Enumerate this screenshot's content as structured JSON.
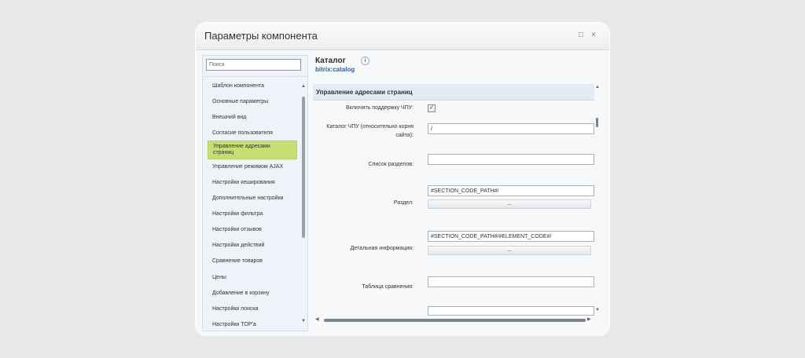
{
  "window": {
    "title": "Параметры компонента",
    "maximize_icon": "□",
    "close_icon": "×"
  },
  "sidebar": {
    "search_placeholder": "Поиск",
    "items": [
      {
        "label": "Шаблон компонента"
      },
      {
        "label": "Основные параметры"
      },
      {
        "label": "Внешний вид"
      },
      {
        "label": "Согласие пользователя"
      },
      {
        "label": "Управление адресами страниц",
        "active": true
      },
      {
        "label": "Управление режимом AJAX"
      },
      {
        "label": "Настройки кеширования"
      },
      {
        "label": "Дополнительные настройки"
      },
      {
        "label": "Настройки фильтра"
      },
      {
        "label": "Настройки отзывов"
      },
      {
        "label": "Настройки действий"
      },
      {
        "label": "Сравнение товаров"
      },
      {
        "label": "Цены"
      },
      {
        "label": "Добавление в корзину"
      },
      {
        "label": "Настройки поиска"
      },
      {
        "label": "Настройки TOP'a"
      }
    ]
  },
  "main": {
    "component_title": "Каталог",
    "component_code": "bitrix:catalog",
    "info_icon": "i",
    "section_title": "Управление адресами страниц",
    "fields": {
      "sef_label": "Включить поддержку ЧПУ:",
      "sef_checked": "✓",
      "root_label": "Каталог ЧПУ (относительно корня сайта):",
      "root_value": "/",
      "sections_label": "Список разделов:",
      "sections_value": "",
      "section_label": "Раздел:",
      "section_value": "#SECTION_CODE_PATH#/",
      "detail_label": "Детальная информация:",
      "detail_value": "#SECTION_CODE_PATH#/#ELEMENT_CODE#/",
      "compare_label": "Таблица сравнения:",
      "compare_value": "",
      "dots_label": "..."
    }
  },
  "colors": {
    "accent_active": "#c8de74",
    "section_bg": "#e3ebf4",
    "code_link": "#2a6496"
  }
}
